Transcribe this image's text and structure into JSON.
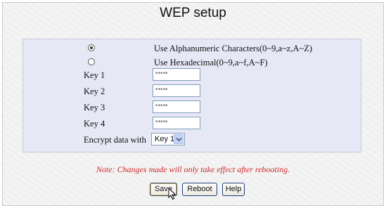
{
  "page": {
    "title": "WEP setup"
  },
  "options": [
    {
      "label": "Use Alphanumeric Characters(0~9,a~z,A~Z)",
      "selected": true
    },
    {
      "label": "Use Hexadecimal(0~9,a~f,A~F)",
      "selected": false
    }
  ],
  "keys": [
    {
      "label": "Key 1",
      "value": "*****"
    },
    {
      "label": "Key 2",
      "value": "*****"
    },
    {
      "label": "Key 3",
      "value": "*****"
    },
    {
      "label": "Key 4",
      "value": "*****"
    }
  ],
  "encrypt": {
    "label": "Encrypt data with",
    "selected": "Key 1",
    "arrow_icon": "chevron-down-icon"
  },
  "note": "Note: Changes made will only take effect after rebooting.",
  "buttons": {
    "save": "Save",
    "reboot": "Reboot",
    "help": "Help"
  },
  "colors": {
    "panel": "#e6e8f6",
    "note": "#cc2a2a",
    "button_border": "#1d3f7a"
  },
  "pointer_icon": "mouse-pointer-icon"
}
